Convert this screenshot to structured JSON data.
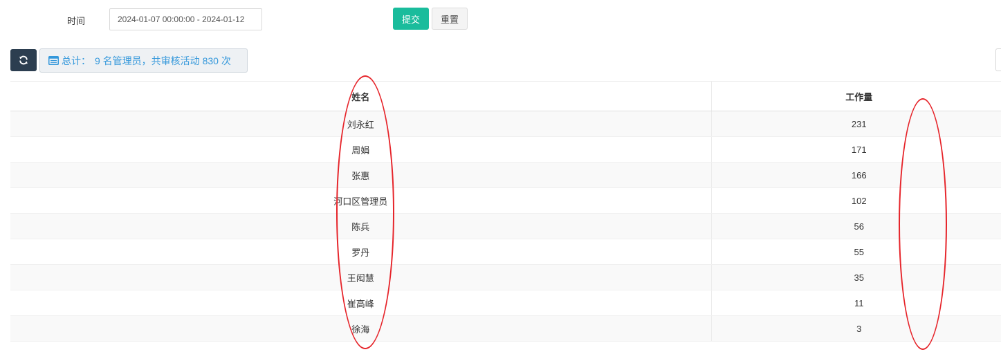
{
  "filter": {
    "time_label": "时间",
    "date_range_value": "2024-01-07 00:00:00 - 2024-01-12",
    "submit_label": "提交",
    "reset_label": "重置"
  },
  "toolbar": {
    "refresh_icon": "refresh-icon",
    "summary_icon": "table-icon",
    "summary_label": "总计：",
    "summary_text": "9 名管理员，共审核活动 830 次"
  },
  "table": {
    "headers": [
      "姓名",
      "工作量"
    ],
    "rows": [
      {
        "name": "刘永红",
        "workload": "231"
      },
      {
        "name": "周娟",
        "workload": "171"
      },
      {
        "name": "张惠",
        "workload": "166"
      },
      {
        "name": "河口区管理员",
        "workload": "102"
      },
      {
        "name": "陈兵",
        "workload": "56"
      },
      {
        "name": "罗丹",
        "workload": "55"
      },
      {
        "name": "王闳慧",
        "workload": "35"
      },
      {
        "name": "崔高峰",
        "workload": "11"
      },
      {
        "name": "徐海",
        "workload": "3"
      }
    ]
  },
  "colors": {
    "submit_bg": "#1abc9c",
    "refresh_bg": "#2c3e50",
    "summary_text": "#3498db",
    "annotation": "#e6242a"
  }
}
